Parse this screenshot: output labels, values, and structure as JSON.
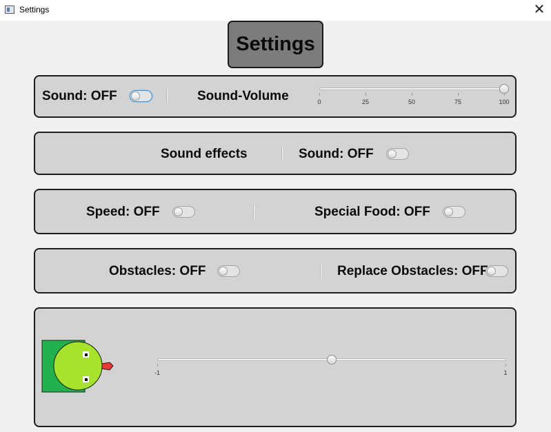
{
  "window": {
    "title": "Settings",
    "close_glyph": "✕"
  },
  "header": {
    "title": "Settings"
  },
  "sound_panel": {
    "sound_label": "Sound: OFF",
    "sound_on": false,
    "volume_label": "Sound-Volume",
    "volume_value": 100,
    "volume_ticks": [
      "0",
      "25",
      "50",
      "75",
      "100"
    ]
  },
  "effects_panel": {
    "effects_label": "Sound effects",
    "sound_label": "Sound: OFF",
    "sound_on": false
  },
  "gameplay_panel": {
    "speed_label": "Speed: OFF",
    "speed_on": false,
    "special_food_label": "Special Food: OFF",
    "special_food_on": false
  },
  "obstacles_panel": {
    "obstacles_label": "Obstacles: OFF",
    "obstacles_on": false,
    "replace_obstacles_label": "Replace Obstacles: OFF",
    "replace_obstacles_on": false
  },
  "snake_panel": {
    "slider_value": 0,
    "slider_min_label": "-1",
    "slider_max_label": "1",
    "colors": {
      "body": "#22b14c",
      "head": "#a6e22e",
      "tongue": "#e53935"
    }
  }
}
